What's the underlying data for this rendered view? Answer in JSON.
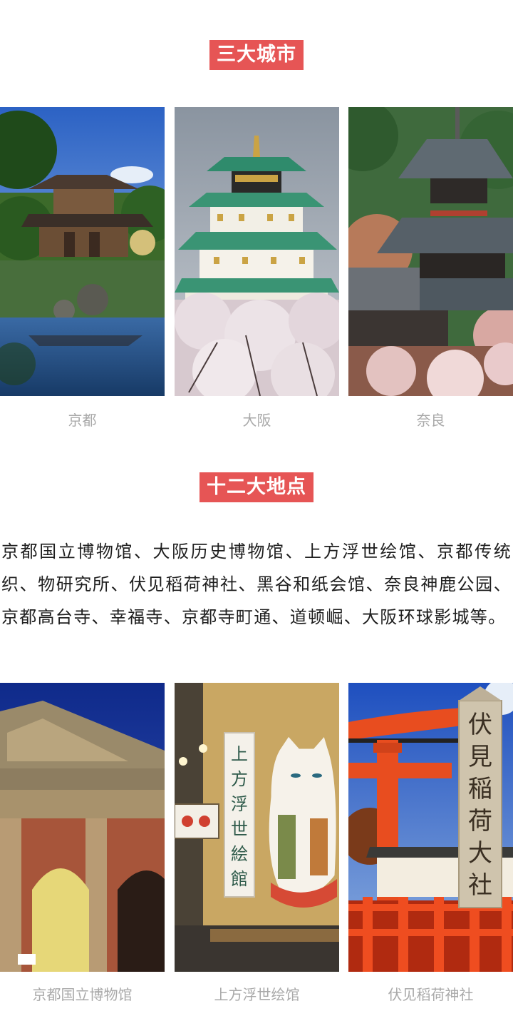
{
  "section1": {
    "title": "三大城市",
    "photos": [
      {
        "caption": "京都",
        "icon": "kinkakuji-pavilion-photo"
      },
      {
        "caption": "大阪",
        "icon": "osaka-castle-photo"
      },
      {
        "caption": "奈良",
        "icon": "nara-pagoda-photo"
      }
    ]
  },
  "section2": {
    "title": "十二大地点",
    "description": "京都国立博物馆、大阪历史博物馆、上方浮世绘馆、京都传统织、物研究所、伏见稻荷神社、黑谷和纸会馆、奈良神鹿公园、京都高台寺、幸福寺、京都寺町通、道顿崛、大阪环球影城等。",
    "photos": [
      {
        "caption": "京都国立博物馆",
        "icon": "kyoto-museum-photo"
      },
      {
        "caption": "上方浮世绘馆",
        "icon": "ukiyoe-museum-photo",
        "sign_text": "上方浮世絵館"
      },
      {
        "caption": "伏见稻荷神社",
        "icon": "fushimi-inari-photo",
        "sign_text": "伏見稲荷大社"
      }
    ]
  },
  "colors": {
    "accent": "#e65555",
    "caption": "#a9a9a9",
    "text": "#1e1e1e"
  }
}
